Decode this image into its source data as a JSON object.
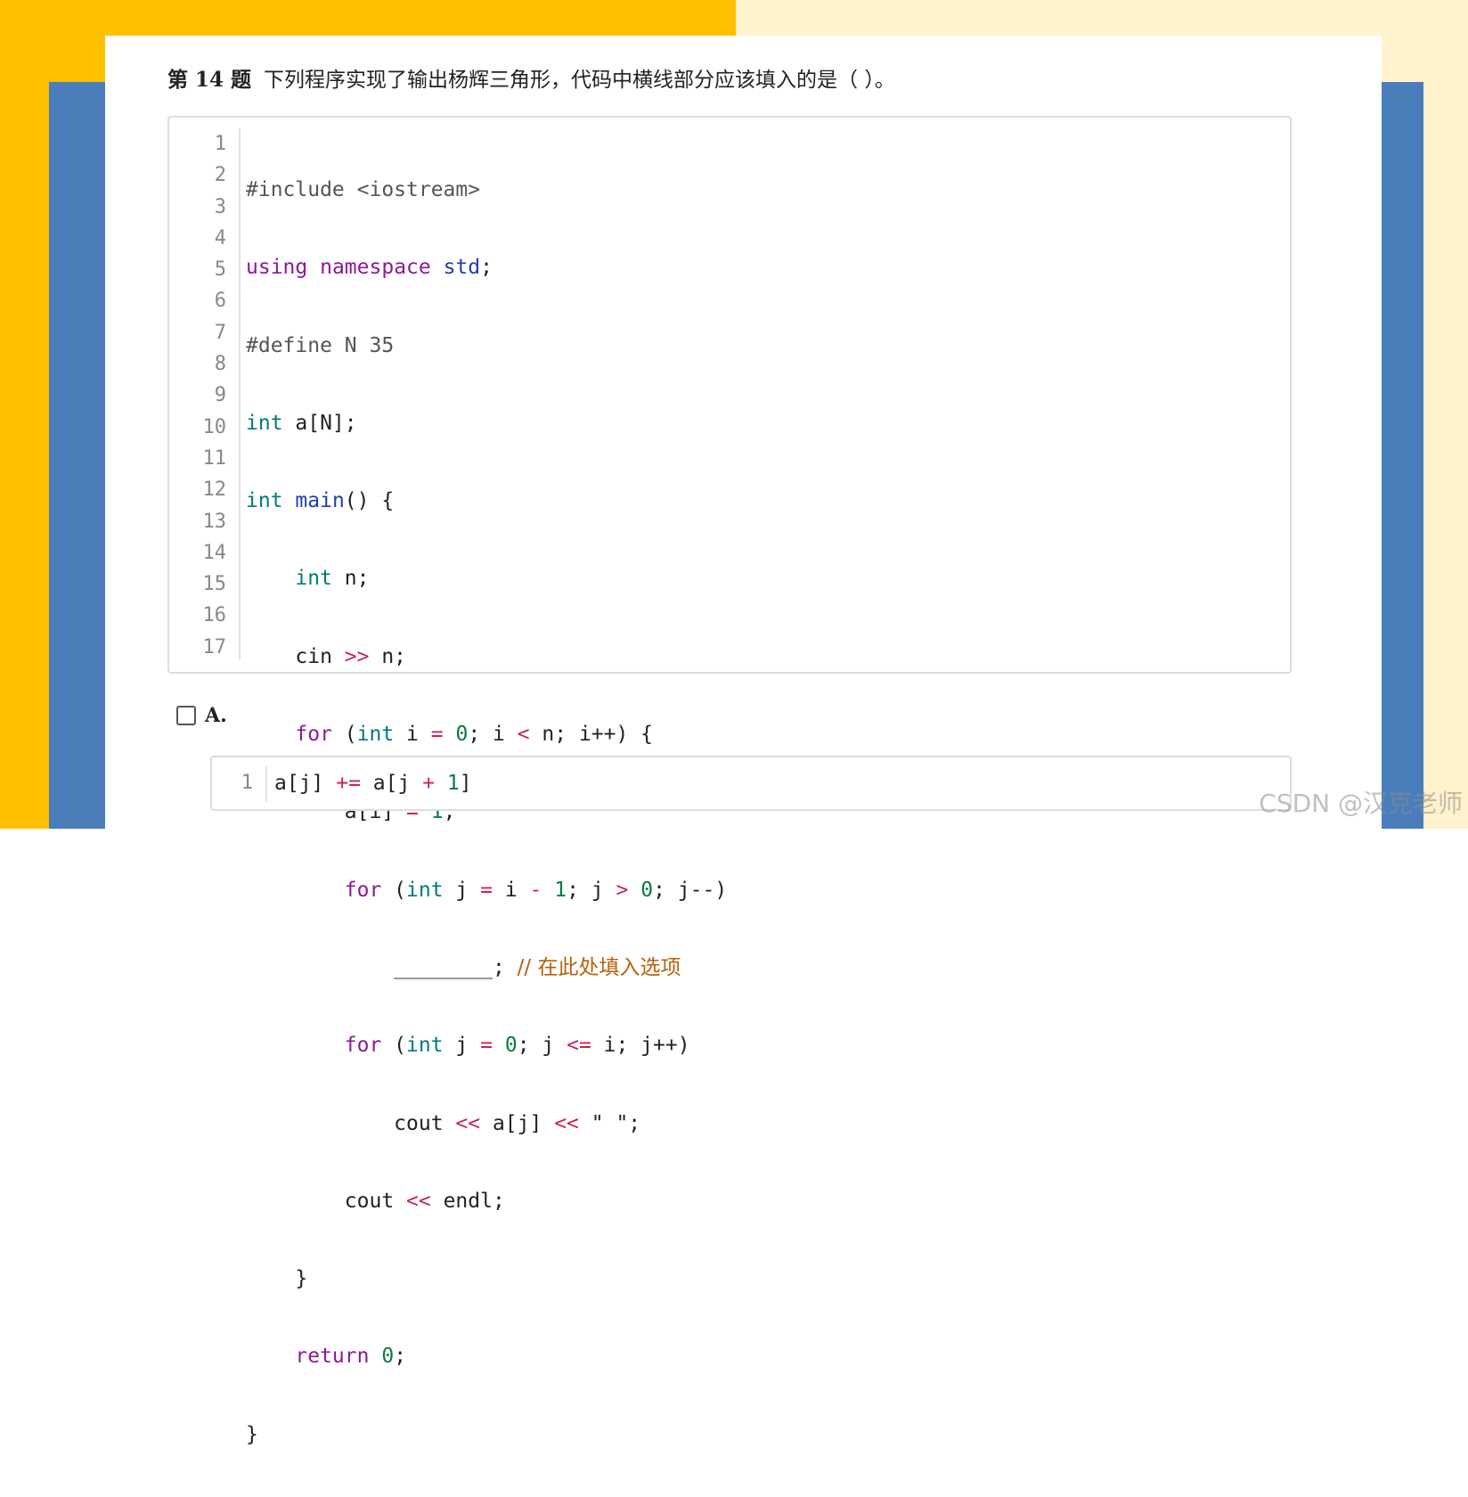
{
  "colors": {
    "bg_left": "#FFC000",
    "bg_right": "#FFF2CC",
    "bg_band": "#4A7EBB",
    "keyword": "#8B1A99",
    "type": "#007A7A",
    "operator": "#C7254E",
    "number": "#0B7A3E",
    "comment": "#B8600A"
  },
  "question": {
    "number": "第 14 题",
    "text": "下列程序实现了输出杨辉三角形，代码中横线部分应该填入的是（ ）。"
  },
  "code": {
    "line_numbers": [
      "1",
      "2",
      "3",
      "4",
      "5",
      "6",
      "7",
      "8",
      "9",
      "10",
      "11",
      "12",
      "13",
      "14",
      "15",
      "16",
      "17"
    ],
    "l1": "#include <iostream>",
    "l2_kw1": "using",
    "l2_kw2": "namespace",
    "l2_id": "std",
    "l3": "#define N 35",
    "l4_type": "int",
    "l4_rest": " a[N];",
    "l5_type": "int",
    "l5_fn": "main",
    "l5_rest": "() {",
    "l6_type": "int",
    "l6_rest": " n;",
    "l7_a": "    cin ",
    "l7_op": ">>",
    "l7_b": " n;",
    "l8_kw": "for",
    "l8_type": "int",
    "l8_i": " i ",
    "l8_eq": "=",
    "l8_zero": "0",
    "l8_mid": "; i ",
    "l8_lt": "<",
    "l8_end": " n; i++) {",
    "l9_a": "        a[i] ",
    "l9_eq": "=",
    "l9_one": "1",
    "l10_kw": "for",
    "l10_type": "int",
    "l10_j": " j ",
    "l10_eq": "=",
    "l10_i": " i ",
    "l10_minus": "-",
    "l10_one": "1",
    "l10_mid": "; j ",
    "l10_gt": ">",
    "l10_zero": "0",
    "l10_end": "; j--)",
    "l11_blank": "            ________;",
    "l11_comment": "// 在此处填入选项",
    "l12_kw": "for",
    "l12_type": "int",
    "l12_j": " j ",
    "l12_eq": "=",
    "l12_zero": "0",
    "l12_mid": "; j ",
    "l12_le": "<=",
    "l12_end": " i; j++)",
    "l13_a": "            cout ",
    "l13_op1": "<<",
    "l13_b": " a[j] ",
    "l13_op2": "<<",
    "l13_c": " \" \";",
    "l14_a": "        cout ",
    "l14_op": "<<",
    "l14_b": " endl;",
    "l15": "    }",
    "l16_kw": "return",
    "l16_zero": "0",
    "l17": "}"
  },
  "option_a": {
    "label": "A.",
    "line_number": "1",
    "code_a": "a[j] ",
    "code_op1": "+=",
    "code_b": " a[j ",
    "code_op2": "+",
    "code_one": "1",
    "code_end": "]"
  },
  "watermark": "CSDN @汉克老师"
}
